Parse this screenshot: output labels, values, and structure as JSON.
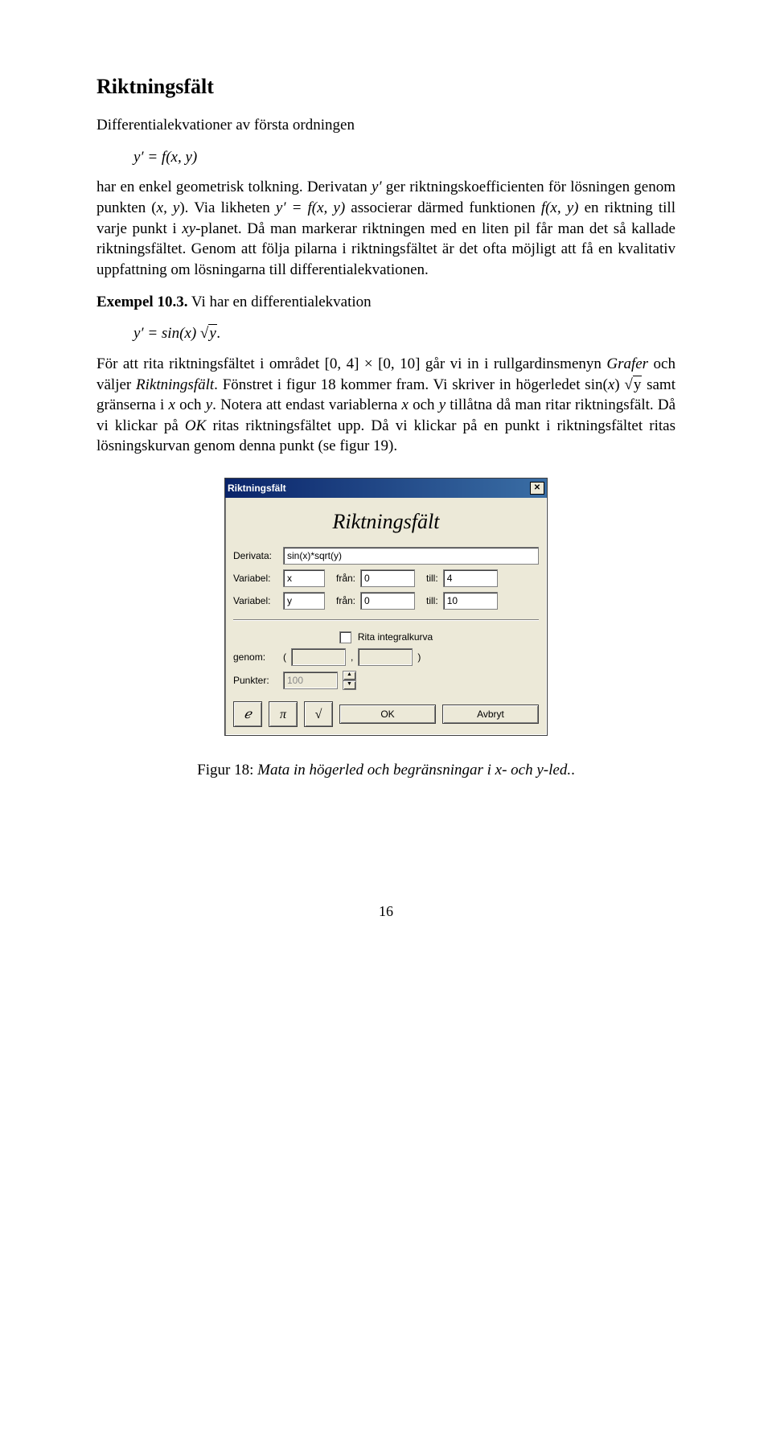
{
  "heading": "Riktningsfält",
  "p1a": "Differentialekvationer av första ordningen",
  "eq1": "y′ = f(x, y)",
  "p1b_a": "har en enkel geometrisk tolkning. Derivatan ",
  "p1b_y": "y′",
  "p1b_b": " ger riktningskoefficienten för lösningen genom punkten (",
  "p1b_xy": "x, y",
  "p1b_c": "). Via likheten ",
  "p1b_eq": "y′ = f(x, y)",
  "p1b_d": " associerar därmed funktionen ",
  "p1b_f": "f(x, y)",
  "p1b_e": " en riktning till varje punkt i ",
  "p1b_xyp": "xy",
  "p1b_f2": "-planet. Då man markerar riktningen med en liten pil får man det så kallade riktningsfältet. Genom att följa pilarna i riktningsfältet är det ofta möjligt att få en kvalitativ uppfattning om lösningarna till differentialekvationen.",
  "ex_label": "Exempel 10.3.",
  "ex_text": " Vi har en differentialekvation",
  "eq2_pre": "y′ = sin(x) ",
  "eq2_rad": "y",
  "eq2_post": ".",
  "p3_a": "För att rita riktningsfältet i området [0, 4] × [0, 10] går vi in i rullgardinsmenyn ",
  "p3_m1": "Grafer",
  "p3_b": " och väljer ",
  "p3_m2": "Riktningsfält",
  "p3_c": ". Fönstret i figur 18 kommer fram. Vi skriver in högerledet sin(",
  "p3_x": "x",
  "p3_d": ") ",
  "p3_rad": "y",
  "p3_e": " samt gränserna i ",
  "p3_x2": "x",
  "p3_f": " och ",
  "p3_y2": "y",
  "p3_g": ". Notera att endast variablerna ",
  "p3_x3": "x",
  "p3_h": " och ",
  "p3_y3": "y",
  "p3_i": " tillåtna då man ritar riktningsfält. Då vi klickar på ",
  "p3_ok": "OK",
  "p3_j": " ritas riktningsfältet upp. Då vi klickar på en punkt i riktningsfältet ritas lösningskurvan genom denna punkt (se figur 19).",
  "dialog": {
    "title": "Riktningsfält",
    "heading": "Riktningsfält",
    "derivata_lbl": "Derivata:",
    "derivata_val": "sin(x)*sqrt(y)",
    "var_lbl": "Variabel:",
    "fran_lbl": "från:",
    "till_lbl": "till:",
    "var1": "x",
    "v1from": "0",
    "v1to": "4",
    "var2": "y",
    "v2from": "0",
    "v2to": "10",
    "cb_lbl": "Rita integralkurva",
    "genom_lbl": "genom:",
    "paren_l": "(",
    "comma": ",",
    "paren_r": ")",
    "punkter_lbl": "Punkter:",
    "punkter_val": "100",
    "btn_e": "ℯ",
    "btn_pi": "π",
    "btn_sqrt": "√",
    "btn_ok": "OK",
    "btn_cancel": "Avbryt"
  },
  "caption_a": "Figur 18: ",
  "caption_b": "Mata in högerled och begränsningar i x- och y-led.",
  "caption_c": ".",
  "pagenum": "16"
}
